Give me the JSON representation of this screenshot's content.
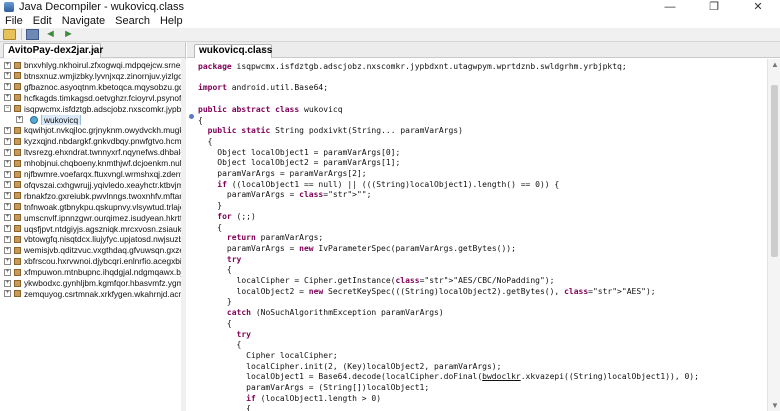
{
  "window": {
    "title": "Java Decompiler - wukovicq.class",
    "minimize_glyph": "—",
    "maximize_glyph": "❐",
    "close_glyph": "✕"
  },
  "menu": [
    "File",
    "Edit",
    "Navigate",
    "Search",
    "Help"
  ],
  "toolbar": {
    "icons": [
      "open-file-icon",
      "save-all-icon",
      "back-icon",
      "forward-icon"
    ],
    "back_glyph": "◄",
    "forward_glyph": "►"
  },
  "left_tab": {
    "label": "AvitoPay-dex2jar.jar",
    "close": "×"
  },
  "tree": {
    "rows": [
      {
        "label": "bnxvhlyg.nkhoirul.zfxogwqi.mdpqejcw.srnepbly",
        "kind": "package",
        "expanded": false
      },
      {
        "label": "btnsxnuz.wmjizbky.lyvnjxqz.zinornjuv.yizlgcnf.qvfttakh",
        "kind": "package",
        "expanded": false
      },
      {
        "label": "gfbaznoc.asyoqtnm.kbetoqca.mqysobzu.gqwfibkl",
        "kind": "package",
        "expanded": false
      },
      {
        "label": "hcfkagds.timkagsd.oetvghzr.fcioyrvl.psynofdj.sz",
        "kind": "package",
        "expanded": false
      },
      {
        "label": "isqpwcmx.isfdztgb.adscjobz.nxscomkr.jypbdxnt.ut",
        "kind": "package",
        "expanded": true
      },
      {
        "label": "wukovicq",
        "kind": "class",
        "selected": true
      },
      {
        "label": "kqwihjot.nvkqjloc.grjnyknm.owydvckh.mugknwod.is",
        "kind": "package",
        "expanded": false
      },
      {
        "label": "kyzxqjnd.nbdargkf.gnkvdbqy.pnwfgtvo.hcmbnvbj",
        "kind": "package",
        "expanded": false
      },
      {
        "label": "ltvsrezg.ehxndrat.twnnyxrf.nqynefws.dhbalcnr.yvzw",
        "kind": "package",
        "expanded": false
      },
      {
        "label": "mhobjnui.chqboeny.knmthjwf.dcjoenkm.nulchqte",
        "kind": "package",
        "expanded": false
      },
      {
        "label": "njfbwmre.voefarqx.ftuxvngl.wrmshxqj.zdenywgn.u",
        "kind": "package",
        "expanded": false
      },
      {
        "label": "ofqvszai.cxhgwrujj.yqivledo.xeayhctr.ktbvjmn.xcwu",
        "kind": "package",
        "expanded": false
      },
      {
        "label": "rbnakfzo.gxreiubk.pwvlnngs.twoxnhfv.mftarcnd.w",
        "kind": "package",
        "expanded": false
      },
      {
        "label": "tnfnwoak.gtbnykpu.qskupnvy.vlsywtud.trlajevf.duc",
        "kind": "package",
        "expanded": false
      },
      {
        "label": "umscnvlf.ipnnzgwr.ourqimez.isudyean.hkrtfibu.pca",
        "kind": "package",
        "expanded": false
      },
      {
        "label": "uqsfjpvt.ntdgiyjs.agszniqk.mrcxvosn.zsiaukrb.atvc",
        "kind": "package",
        "expanded": false
      },
      {
        "label": "vbtowgfq.nisqtdcx.liujyfyc.upjatosd.nwjsuzbt.wrpx",
        "kind": "package",
        "expanded": false
      },
      {
        "label": "wemisjvb.qditzvuc.vxgthdaq.gfvuwsqn.gxzenipb.sxb",
        "kind": "package",
        "expanded": false
      },
      {
        "label": "xbfrscou.hxrvwnoi.djybcqri.enlnrfio.acegxbiu.hejprt",
        "kind": "package",
        "expanded": false
      },
      {
        "label": "xfmpuwon.mtnbupnc.ihqdgjal.ndgmqawx.bjunebio",
        "kind": "package",
        "expanded": false
      },
      {
        "label": "ykwbodxc.gynhljbm.kgmfqor.hbasvmfz.ygmcryvk",
        "kind": "package",
        "expanded": false
      },
      {
        "label": "zemquyog.csrtmnak.xrkfygen.wkahrnjd.acnfunjb.gx",
        "kind": "package",
        "expanded": false
      }
    ]
  },
  "editor_tab": {
    "label": "wukovicq.class",
    "close": "×"
  },
  "code": {
    "lines": [
      "package isqpwcmx.isfdztgb.adscjobz.nxscomkr.jypbdxnt.utagwpym.wprtdznb.swldgrhm.yrbjpktq;",
      "",
      "import android.util.Base64;",
      "",
      "public abstract class wukovicq",
      "{",
      "  public static String podxivkt(String... paramVarArgs)",
      "  {",
      "    Object localObject1 = paramVarArgs[0];",
      "    Object localObject2 = paramVarArgs[1];",
      "    paramVarArgs = paramVarArgs[2];",
      "    if ((localObject1 == null) || (((String)localObject1).length() == 0)) {",
      "      paramVarArgs = \"\";",
      "    }",
      "    for (;;)",
      "    {",
      "      return paramVarArgs;",
      "      paramVarArgs = new IvParameterSpec(paramVarArgs.getBytes());",
      "      try",
      "      {",
      "        localCipher = Cipher.getInstance(\"AES/CBC/NoPadding\");",
      "        localObject2 = new SecretKeySpec(((String)localObject2).getBytes(), \"AES\");",
      "      }",
      "      catch (NoSuchAlgorithmException paramVarArgs)",
      "      {",
      "        try",
      "        {",
      "          Cipher localCipher;",
      "          localCipher.init(2, (Key)localObject2, paramVarArgs);",
      "          localObject1 = Base64.decode(localCipher.doFinal(bwdoclkr.xkvazepi((String)localObject1)), 0);",
      "          paramVarArgs = (String[])localObject1;",
      "          if (localObject1.length > 0)",
      "          {"
    ]
  }
}
